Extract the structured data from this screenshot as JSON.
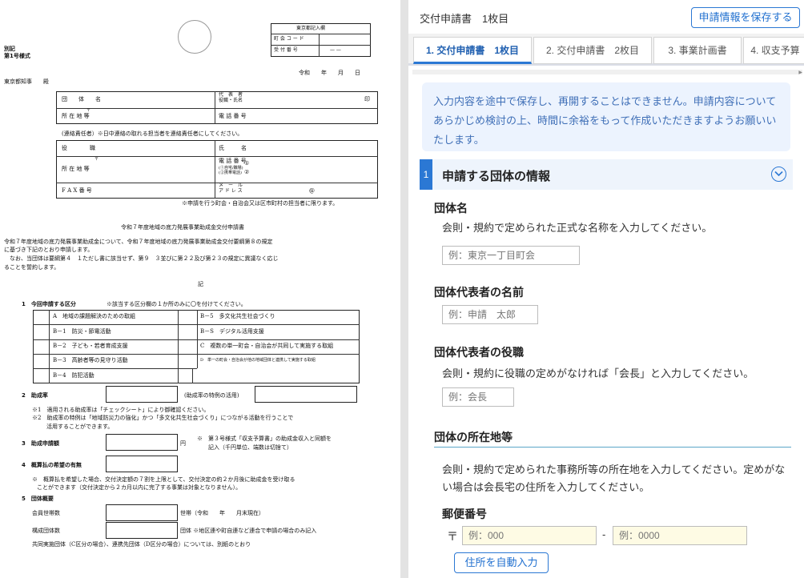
{
  "document": {
    "beppyo": "別記",
    "form_no": "第1号様式",
    "tokyo_box_title": "東京都記入欄",
    "town_code_label": "町 会 コ ー ド",
    "receipt_no_label": "受 付 番 号",
    "receipt_no_value": "—    —",
    "date_line": "令和　　年　　月　　日",
    "addressee": "東京都知事　　殿",
    "group_name_label": "団　　体　　名",
    "rep_label": "代　表　者\n役職・氏名",
    "seal": "印",
    "address_label": "所 在 地 等",
    "postal_mark": "〒",
    "phone_label": "電 話 番 号",
    "contact_note": "(連絡責任者）※日中連絡の取れる担当者を連絡責任者にしてください。",
    "position_label": "役　　　　職",
    "name_label": "氏　　　名",
    "address_label2": "所 在 地 等",
    "phone_label2": "電 話 番 号",
    "phone_sub": "(①自宅/職場)\n(②携帯電話)",
    "phone_1": "①",
    "phone_2": "②",
    "fax_label": "F A X 番 号",
    "mail_label": "メ　ー　ル\nア ド レ ス",
    "at_mark": "@",
    "apply_note": "※申請を行う町会・自治会又は区市町村の担当者に限ります。",
    "doc_title": "令和７年度地域の底力発展事業助成金交付申請書",
    "body_1": "令和７年度地域の底力発展事業助成金について、令和７年度地域の底力発展事業助成金交付要綱第８の規定",
    "body_2": "に基づき下記のとおり申請します。",
    "body_3": "なお、当団体は要綱第４　１ただし書に該当せず、第９　３並びに第２２及び第２３の規定に異議なく応じ",
    "body_4": "ることを誓約します。",
    "ki": "記",
    "s1_title": "1　今回申請する区分",
    "s1_note": "※該当する区分欄の１か所のみに〇を付けてください。",
    "kubun": [
      "A　地域の課題解決のための取組",
      "B－5　多文化共生社会づくり",
      "B－1　防災・節電活動",
      "B－S　デジタル活用支援",
      "B－2　子ども・若者育成支援",
      "C　複数の単一町会・自治会が共同して実施する取組",
      "B－3　高齢者等の見守り活動",
      "D　単一の町会・自治会が他の地域団体と連携して実施する取組",
      "B－4　防犯活動"
    ],
    "s2_title": "2　助成率",
    "s2_special": "(助成率の特例の活用)",
    "s2_note1": "※1　適用される助成率は「チェックシート」により御確認ください。",
    "s2_note2": "※2　助成率の特例は「地域防災力の強化」かつ「多文化共生社会づくり」につながる活動を行うことで",
    "s2_note3": "活用することができます。",
    "s3_title": "3　助成申請額",
    "s3_yen": "円",
    "s3_note1": "※　第３号様式「収支予算書」の助成金収入と同額を",
    "s3_note2": "記入（千円単位、端数は切捨て）",
    "s4_title": "4　概算払の希望の有無",
    "s4_note1": "※　概算払を希望した場合、交付決定額の７割を上限として、交付決定の約２か月後に助成金を受け取る",
    "s4_note2": "ことができます（交付決定から２カ月以内に完了する事業は対象となりません）。",
    "s5_title": "5　団体概要",
    "households_label": "会員世帯数",
    "households_unit": "世帯（令和　　年　　月末現在）",
    "members_label": "構成団体数",
    "members_unit": "団体 ※地区連や町自連など連合で申請の場合のみ記入",
    "joint_note": "共同実施団体（C区分の場合）、連携先団体（D区分の場合）については、別紙のとおり"
  },
  "panel": {
    "top_title": "交付申請書　1枚目",
    "save_button": "申請情報を保存する",
    "tabs": [
      {
        "label": "1. 交付申請書　1枚目",
        "active": true
      },
      {
        "label": "2. 交付申請書　2枚目",
        "active": false
      },
      {
        "label": "3. 事業計画書",
        "active": false
      },
      {
        "label": "4. 収支予算",
        "active": false
      }
    ],
    "notice": "入力内容を途中で保存し、再開することはできません。申請内容についてあらかじめ検討の上、時間に余裕をもって作成いただきますようお願いいたします。",
    "section_number": "1",
    "section_title": "申請する団体の情報",
    "fields": {
      "group_name_label": "団体名",
      "group_name_desc": "会則・規約で定められた正式な名称を入力してください。",
      "group_name_placeholder": "例：東京一丁目町会",
      "rep_name_label": "団体代表者の名前",
      "rep_name_placeholder": "例：申請　太郎",
      "rep_title_label": "団体代表者の役職",
      "rep_title_desc": "会則・規約に役職の定めがなければ「会長」と入力してください。",
      "rep_title_placeholder": "例：会長",
      "address_label": "団体の所在地等",
      "address_desc": "会則・規約で定められた事務所等の所在地を入力してください。定めがない場合は会長宅の住所を入力してください。",
      "postal_label": "郵便番号",
      "postal_mark": "〒",
      "postal_placeholder_1": "例：000",
      "postal_dash": "-",
      "postal_placeholder_2": "例：0000",
      "auto_address_button": "住所を自動入力"
    }
  }
}
